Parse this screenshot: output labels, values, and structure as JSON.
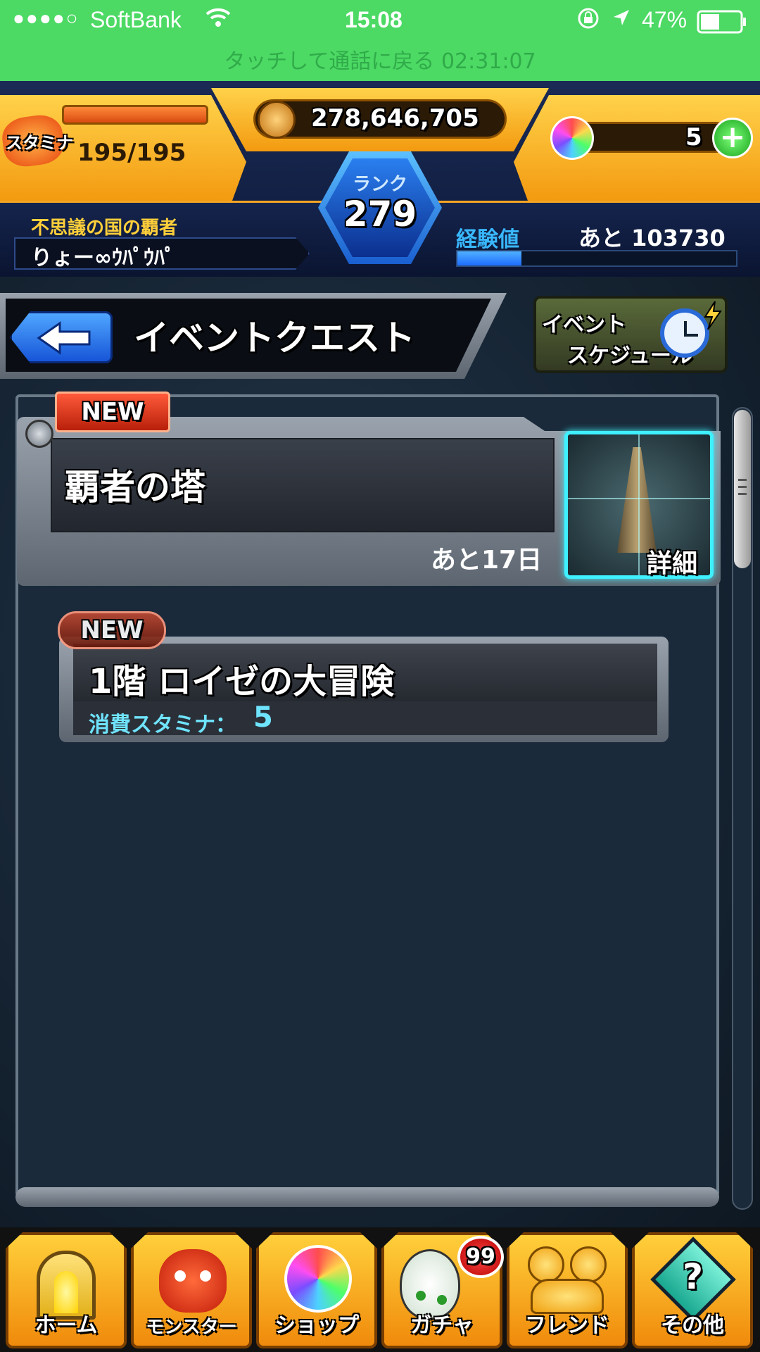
{
  "status_bar": {
    "signal": "●●●●○",
    "carrier": "SoftBank",
    "time": "15:08",
    "battery": "47%",
    "call_banner": "タッチして通話に戻る 02:31:07"
  },
  "header": {
    "stamina_label": "スタミナ",
    "stamina_value": "195/195",
    "coins": "278,646,705",
    "orbs": "5",
    "rank_label": "ランク",
    "rank_value": "279",
    "player_title": "不思議の国の覇者",
    "player_name": "りょー∞ｳﾊﾟｳﾊﾟ",
    "exp_label": "経験値",
    "exp_remaining": "あと 103730",
    "exp_progress": 0.23
  },
  "nav": {
    "back_label": "",
    "page_title": "イベントクエスト",
    "schedule_label_1": "イベント",
    "schedule_label_2": "スケジュール"
  },
  "event": {
    "badge": "NEW",
    "title": "覇者の塔",
    "remaining": "あと17日",
    "detail_label": "詳細"
  },
  "stage": {
    "badge": "NEW",
    "title": "1階 ロイゼの大冒険",
    "stamina_label": "消費スタミナ：",
    "stamina_value": "5"
  },
  "tabs": [
    {
      "label": "ホーム"
    },
    {
      "label": "モンスター"
    },
    {
      "label": "ショップ"
    },
    {
      "label": "ガチャ",
      "badge": "99"
    },
    {
      "label": "フレンド"
    },
    {
      "label": "その他"
    }
  ],
  "colors": {
    "status_green": "#4cd964",
    "gold": "#f5a623",
    "exp_bar": "#1e7bff",
    "accent_cyan": "#6fe4ff"
  }
}
